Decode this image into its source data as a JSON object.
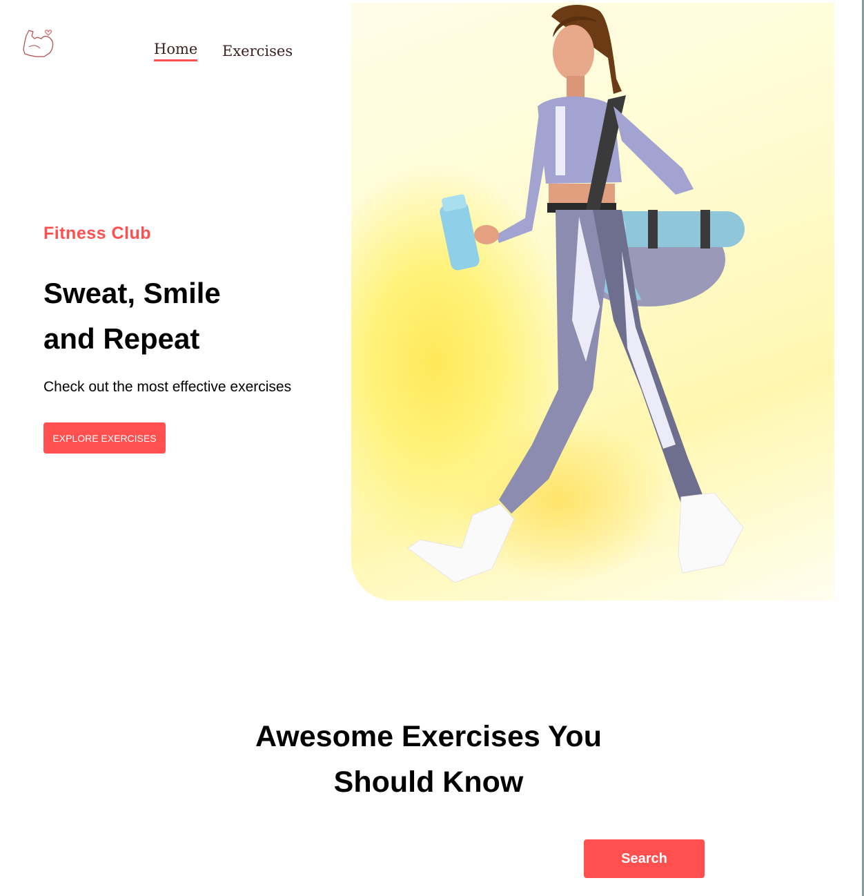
{
  "brand": {
    "logo_icon": "flexed-arm-heart-icon",
    "accent_color": "#ff4f4f"
  },
  "nav": {
    "items": [
      {
        "label": "Home",
        "active": true
      },
      {
        "label": "Exercises",
        "active": false
      }
    ]
  },
  "hero": {
    "eyebrow": "Fitness Club",
    "title_line1": "Sweat, Smile",
    "title_line2": "and Repeat",
    "subtitle": "Check out the most effective exercises",
    "button_label": "EXPLORE EXERCISES",
    "banner_image": "woman-walking-with-gym-bag-and-shaker-image"
  },
  "exercises_section": {
    "title_line1": "Awesome Exercises You",
    "title_line2": "Should Know",
    "search_button_label": "Search"
  }
}
